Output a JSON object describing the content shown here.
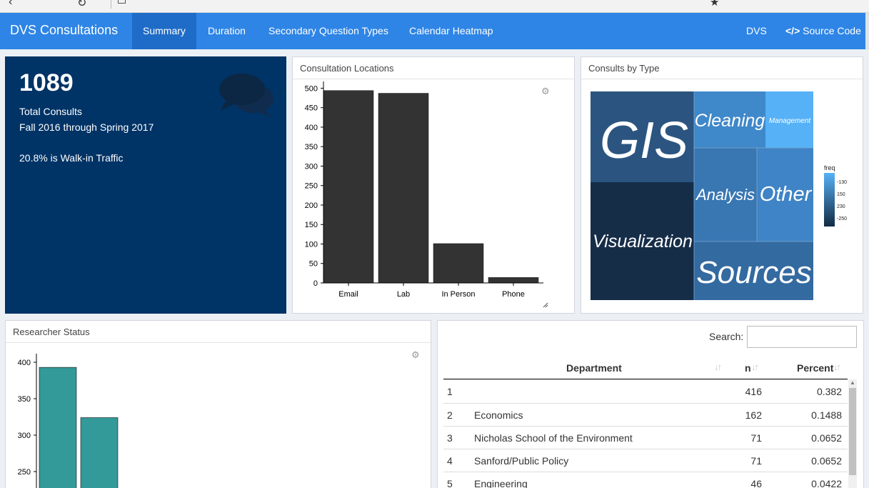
{
  "navbar": {
    "brand": "DVS Consultations",
    "tabs": [
      {
        "label": "Summary",
        "active": true
      },
      {
        "label": "Duration",
        "active": false
      },
      {
        "label": "Secondary Question Types",
        "active": false
      },
      {
        "label": "Calendar Heatmap",
        "active": false
      }
    ],
    "right_links": [
      "DVS",
      "Source Code"
    ],
    "accent_color": "#2e85e6"
  },
  "value_box": {
    "value": "1089",
    "subtitle": "Total Consults",
    "period": "Fall 2016 through Spring 2017",
    "note": "20.8% is Walk-in Traffic",
    "icon": "comments-icon",
    "color": "#003366"
  },
  "locations_card": {
    "title": "Consultation Locations"
  },
  "types_card": {
    "title": "Consults by Type"
  },
  "status_card": {
    "title": "Researcher Status"
  },
  "table": {
    "search_label": "Search:",
    "search_value": "",
    "columns": [
      "Department",
      "n",
      "Percent"
    ],
    "rows": [
      [
        "1",
        "",
        "416",
        "0.382"
      ],
      [
        "2",
        "Economics",
        "162",
        "0.1488"
      ],
      [
        "3",
        "Nicholas School of the Environment",
        "71",
        "0.0652"
      ],
      [
        "4",
        "Sanford/Public Policy",
        "71",
        "0.0652"
      ],
      [
        "5",
        "Engineering",
        "46",
        "0.0422"
      ]
    ]
  },
  "chart_data": [
    {
      "type": "bar",
      "categories": [
        "Email",
        "Lab",
        "In Person",
        "Phone"
      ],
      "values": [
        494,
        487,
        101,
        14
      ],
      "ylim": [
        0,
        510
      ],
      "yticks": [
        0,
        50,
        100,
        150,
        200,
        250,
        300,
        350,
        400,
        450,
        500
      ],
      "bar_color": "#333333"
    },
    {
      "type": "heatmap",
      "subtype": "treemap",
      "cells": [
        {
          "label": "GIS",
          "freq": 162
        },
        {
          "label": "Visualization",
          "freq": 250
        },
        {
          "label": "Cleaning",
          "freq": 125
        },
        {
          "label": "Management",
          "freq": 70
        },
        {
          "label": "Analysis",
          "freq": 140
        },
        {
          "label": "Other",
          "freq": 140
        },
        {
          "label": "Sources",
          "freq": 170
        }
      ],
      "legend": {
        "title": "freq",
        "ticks": [
          "-130",
          "150",
          "230",
          "-250"
        ],
        "placement": "right"
      }
    },
    {
      "type": "bar",
      "values": [
        393,
        324
      ],
      "ylim": [
        230,
        410
      ],
      "yticks": [
        250,
        300,
        350,
        400
      ],
      "bar_color": "#339999"
    }
  ]
}
